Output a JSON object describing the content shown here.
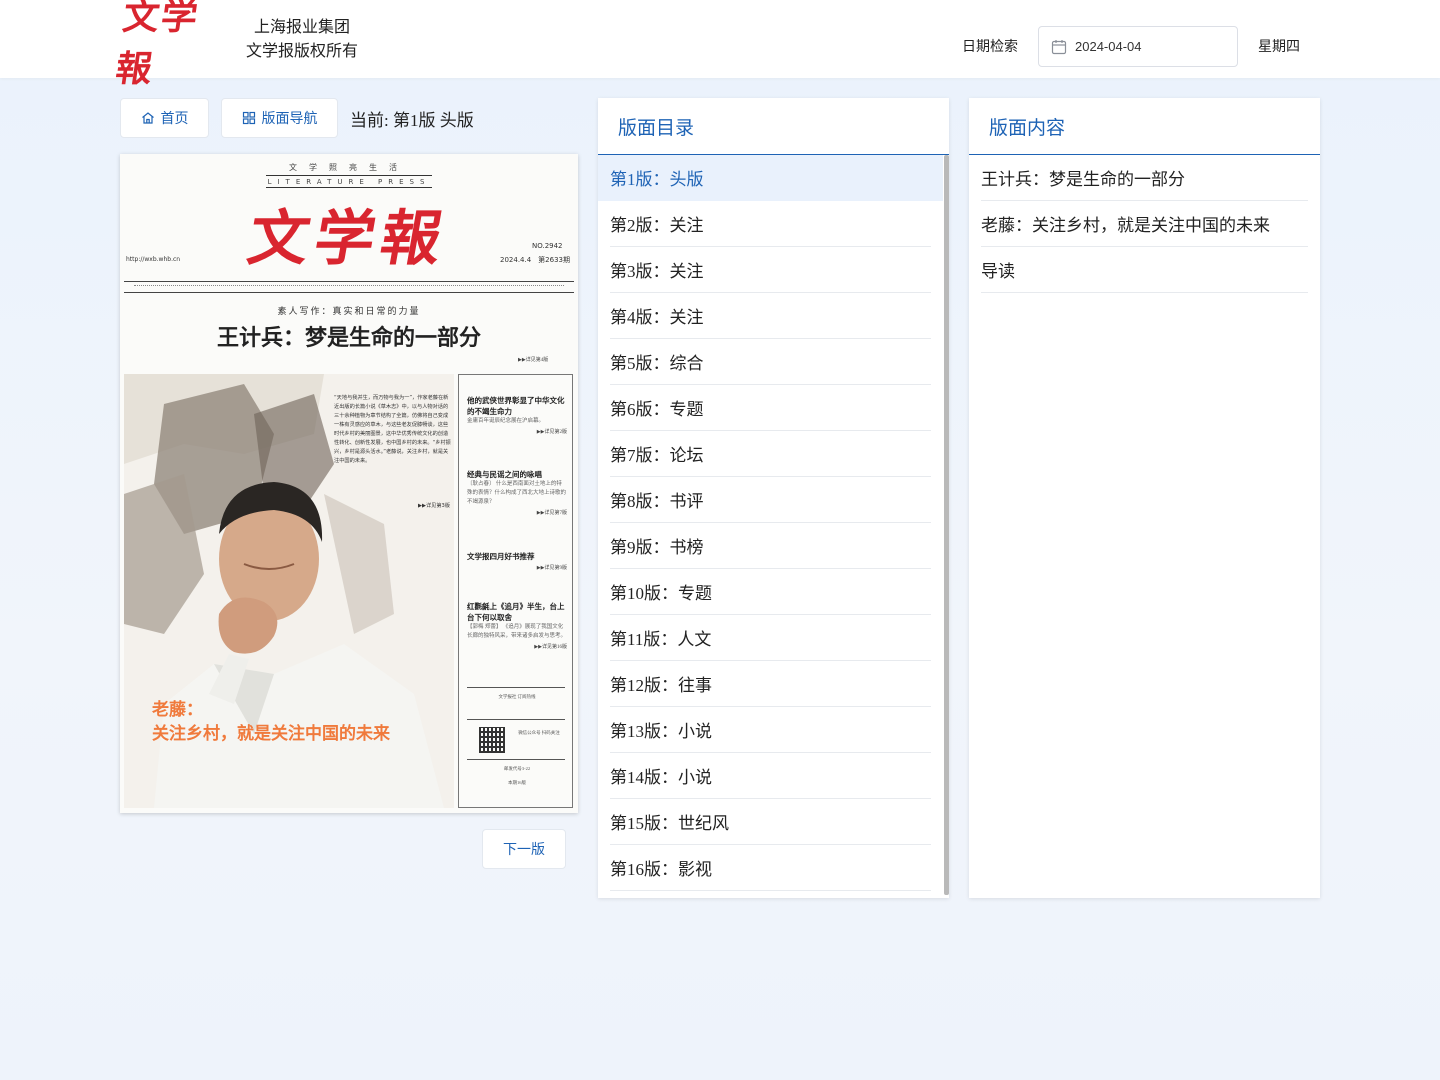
{
  "header": {
    "logo_text": "文学報",
    "group_name": "上海报业集团",
    "copyright": "文学报版权所有",
    "date_search_label": "日期检索",
    "date_value": "2024-04-04",
    "weekday": "星期四"
  },
  "toolbar": {
    "home_label": "首页",
    "nav_label": "版面导航",
    "current_text": "当前: 第1版 头版",
    "next_label": "下一版"
  },
  "newspaper": {
    "top_line": "文学照亮生活",
    "press_line": "LITERATURE PRESS",
    "masthead": "文学報",
    "url": "http://wxb.whb.cn",
    "number": "NO.2942",
    "issue_date": "2024.4.4　第2633期",
    "kicker": "素人写作：真实和日常的力量",
    "headline": "王计兵：梦是生命的一部分",
    "headline_ref": "▶▶详见第4版",
    "story_text": "“天地与我并生，而万物与我为一”，作家老藤在新近出版的长篇小说《草木志》中，以与人物对话的三十余种植物为章节结构了全篇，仿佛将自己变成一株有灵感应的草木，与这些老友促膝畅谈，这些时代乡村的美丽图景，这中华优秀传统文化的创造性转化、创新性发展，也中国乡村的未来。“乡村振兴，乡村是源头活水。”老藤说，关注乡村，就是关注中国的未来。",
    "story_ref": "▶▶详见第3版",
    "photo_title_line1": "老藤：",
    "photo_title_line2": "关注乡村，就是关注中国的未来",
    "sidebar": [
      {
        "title": "他的武侠世界彰显了中华文化的不竭生命力",
        "sub": "金庸百年诞辰纪念展在沪启幕。",
        "ref": "▶▶详见第2版"
      },
      {
        "title": "经典与民谣之间的咏唱",
        "sub": "〔耿占春〕 什么是西南面对土地上的特殊的表情？什么构成了西北大地上诗歌的不竭源泉？",
        "ref": "▶▶详见第7版"
      },
      {
        "title": "文学报四月好书推荐",
        "sub": "",
        "ref": "▶▶详见第9版"
      },
      {
        "title": "红氍毹上《追月》半生，台上台下何以取舍",
        "sub": "【郭梅 郑蕾】 《追月》展现了我国文化长廊的独特风采，带来诸多启发与思考。",
        "ref": "▶▶详见第16版"
      }
    ],
    "sidebar_footer_1": "文学报社 订阅热线",
    "sidebar_footer_2": "微信公众号 扫码关注",
    "sidebar_footer_3": "邮发代号3-22",
    "sidebar_footer_4": "本期16版"
  },
  "directory": {
    "title": "版面目录",
    "items": [
      "第1版：头版",
      "第2版：关注",
      "第3版：关注",
      "第4版：关注",
      "第5版：综合",
      "第6版：专题",
      "第7版：论坛",
      "第8版：书评",
      "第9版：书榜",
      "第10版：专题",
      "第11版：人文",
      "第12版：往事",
      "第13版：小说",
      "第14版：小说",
      "第15版：世纪风",
      "第16版：影视"
    ]
  },
  "content": {
    "title": "版面内容",
    "items": [
      "王计兵：梦是生命的一部分",
      "老藤：关注乡村，就是关注中国的未来",
      "导读"
    ]
  },
  "colors": {
    "accent": "#1e63b5",
    "masthead_red": "#d9252f",
    "highlight_orange": "#f07a3c",
    "active_bg": "#e9f1fc"
  }
}
